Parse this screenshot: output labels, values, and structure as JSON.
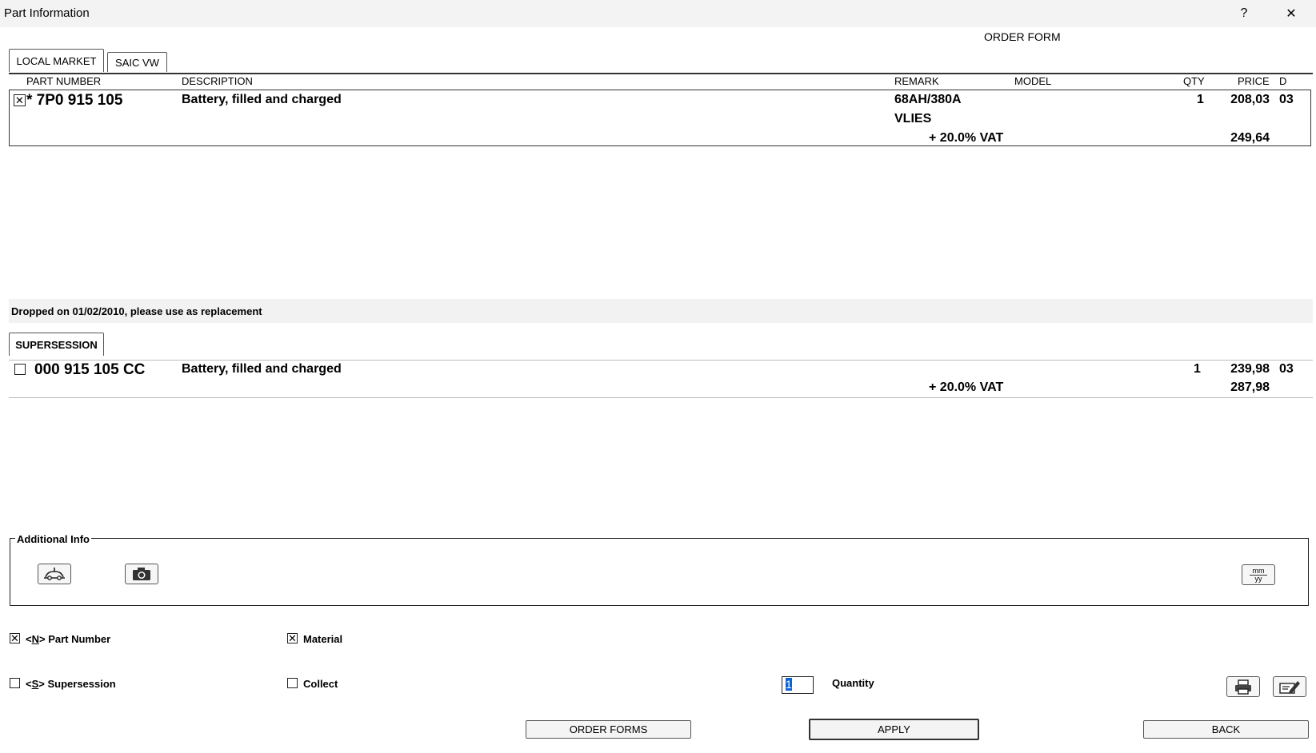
{
  "window": {
    "title": "Part Information",
    "help_label": "?",
    "close_label": "✕"
  },
  "order_form_label": "ORDER FORM",
  "tabs_top": [
    {
      "label": "LOCAL MARKET",
      "active": true
    },
    {
      "label": "SAIC VW",
      "active": false
    }
  ],
  "columns": {
    "part_number": "PART NUMBER",
    "description": "DESCRIPTION",
    "remark": "REMARK",
    "model": "MODEL",
    "qty": "QTY",
    "price": "PRICE",
    "d": "D"
  },
  "main_part": {
    "checked": true,
    "checkbox_glyph": "✕",
    "part_number": "* 7P0 915 105",
    "description": "Battery, filled and charged",
    "remark_1": "68AH/380A",
    "remark_2": "VLIES",
    "qty": "1",
    "price": "208,03",
    "d": "03",
    "vat_label": "+ 20.0% VAT",
    "price_with_vat": "249,64"
  },
  "dropped_note": "Dropped on 01/02/2010, please use as replacement",
  "supersession_tab": "SUPERSESSION",
  "supersession_part": {
    "checked": false,
    "part_number": "000 915 105 CC",
    "description": "Battery, filled and charged",
    "qty": "1",
    "price": "239,98",
    "d": "03",
    "vat_label": "+ 20.0% VAT",
    "price_with_vat": "287,98"
  },
  "additional_info": {
    "legend": "Additional Info",
    "icons": [
      "car-lift-icon",
      "camera-icon",
      "month-year-icon"
    ],
    "mm_label": "mm",
    "yy_label": "yy"
  },
  "options": {
    "part_number": {
      "label": "Part Number",
      "key": "N",
      "checked": true,
      "glyph": "✕"
    },
    "material": {
      "label": "Material",
      "checked": true,
      "glyph": "✕"
    },
    "supersession": {
      "label": "Supersession",
      "key": "S",
      "checked": false
    },
    "collect": {
      "label": "Collect",
      "checked": false
    }
  },
  "quantity": {
    "label": "Quantity",
    "value": "1"
  },
  "buttons": {
    "order_forms": "ORDER FORMS",
    "apply": "APPLY",
    "back": "BACK"
  },
  "colors": {
    "note_bg": "#f2f2f2",
    "titlebar_bg": "#f3f3f3",
    "selection": "#0a64d8"
  }
}
